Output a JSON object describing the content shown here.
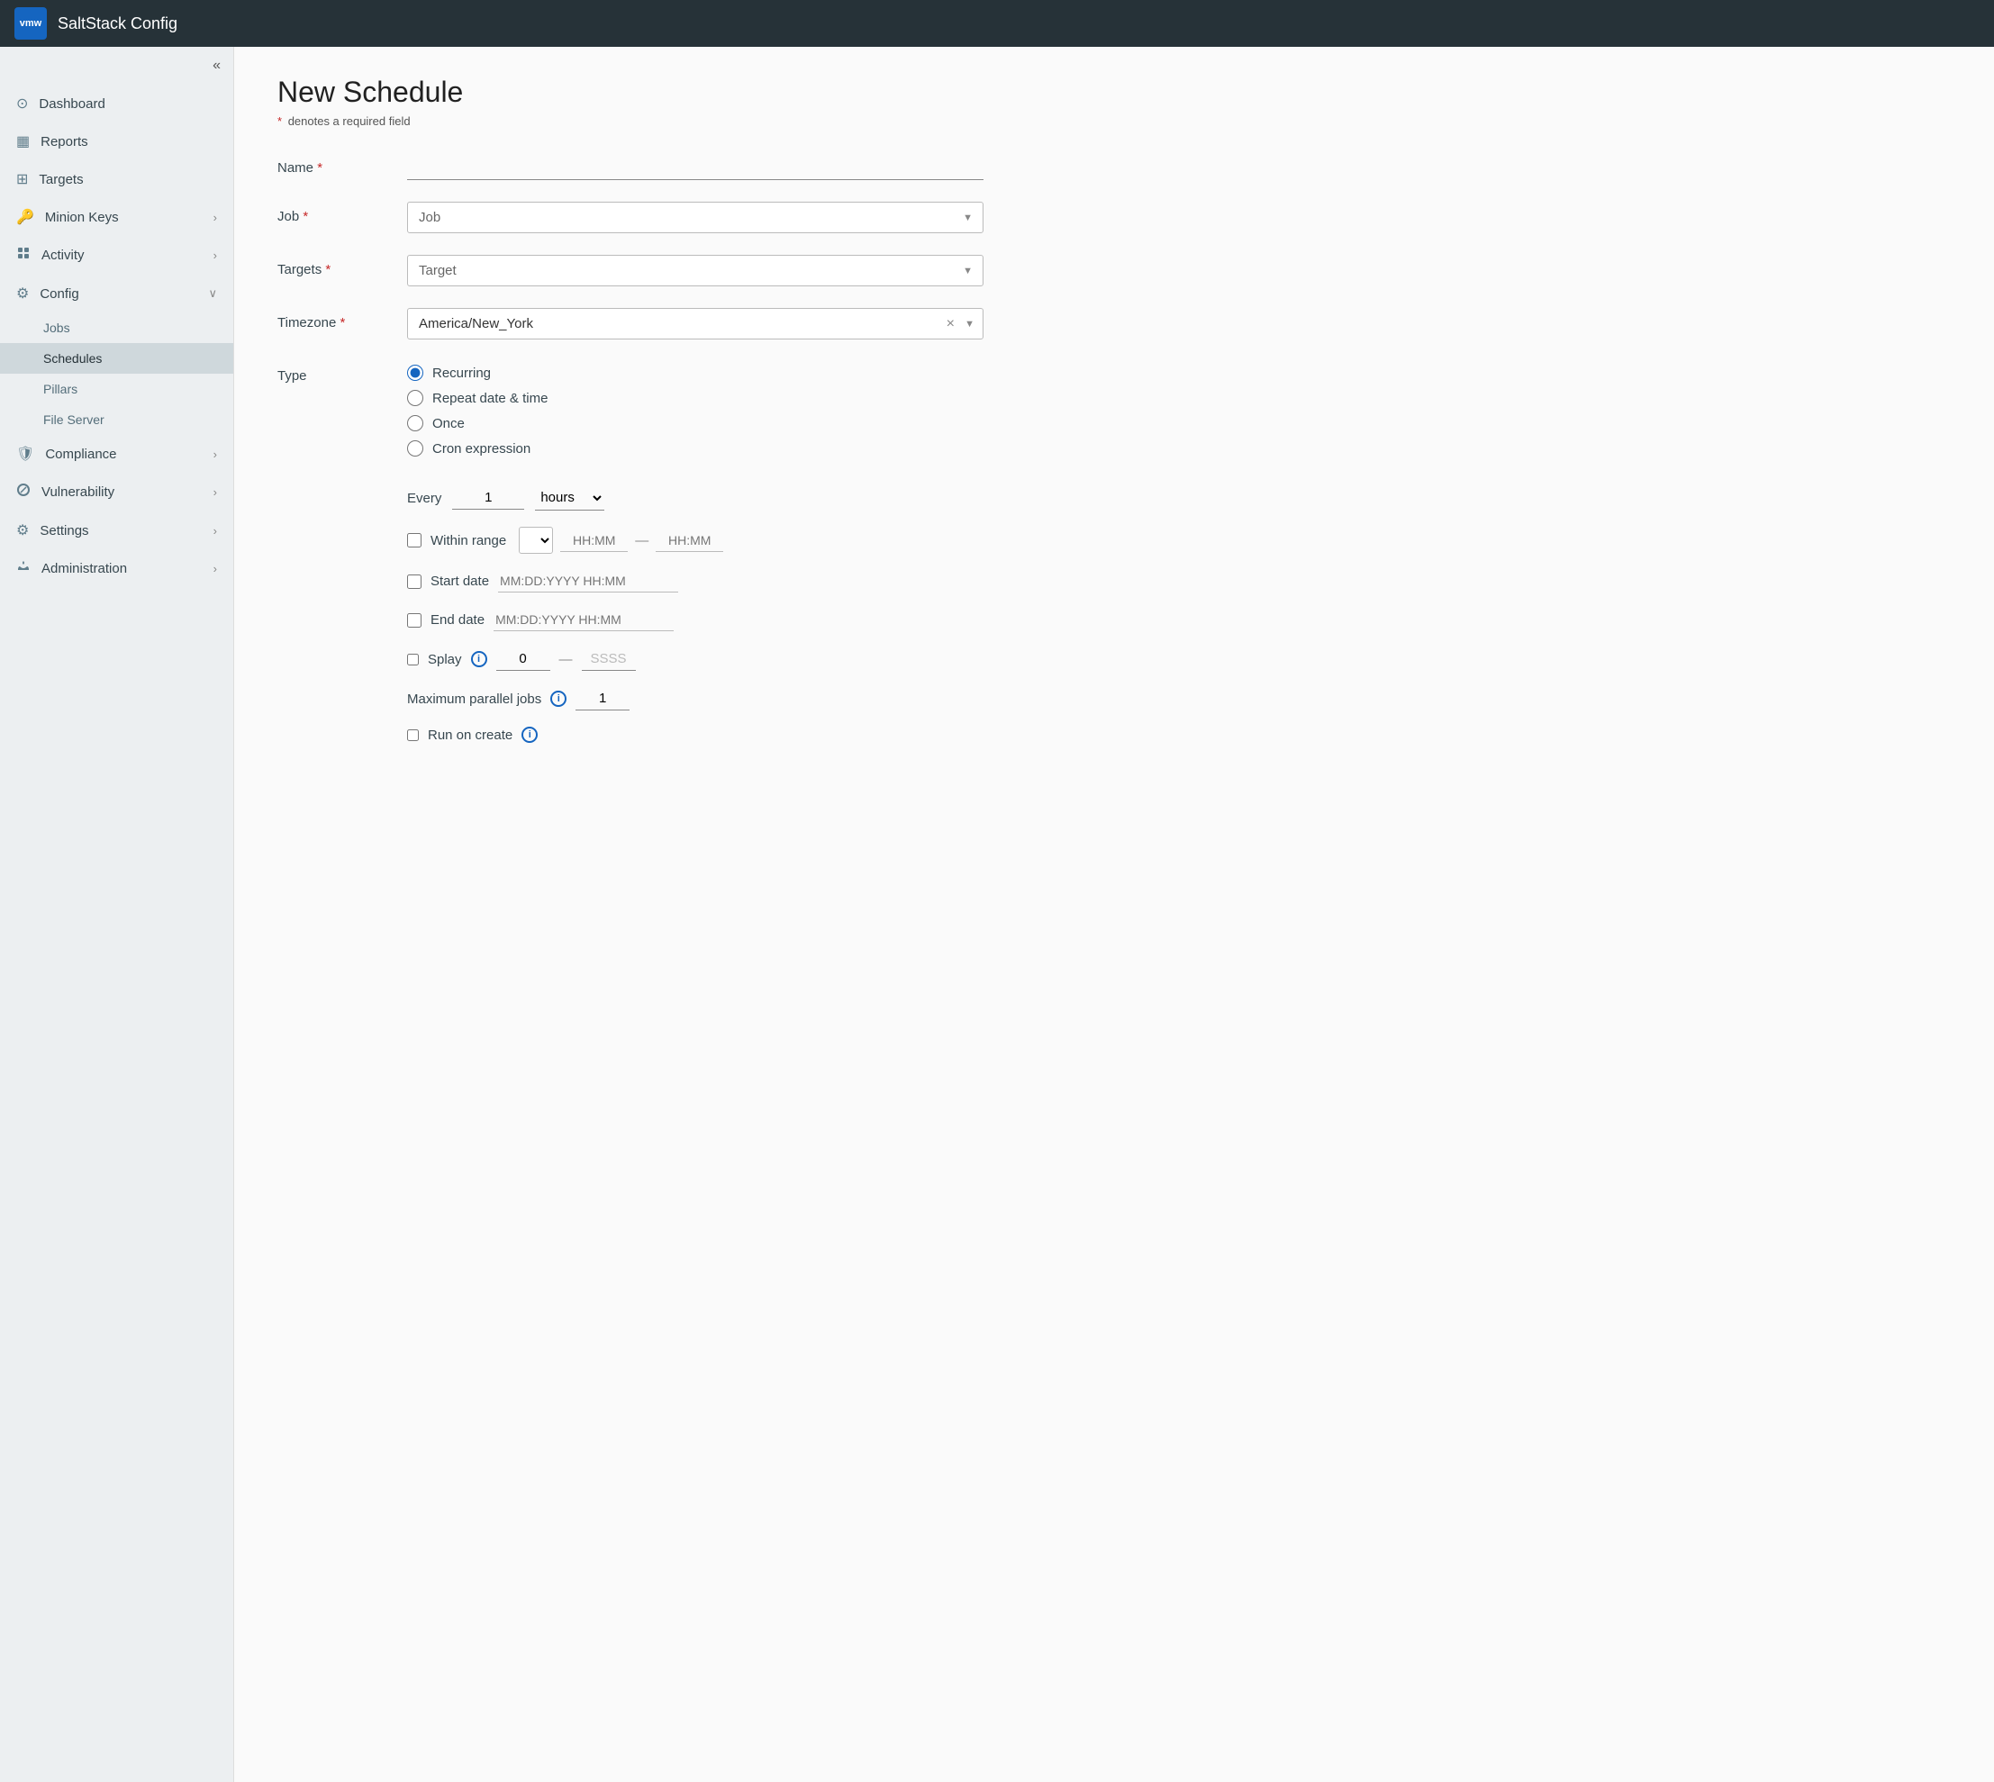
{
  "app": {
    "logo": "vmw",
    "title": "SaltStack Config"
  },
  "sidebar": {
    "collapse_label": "«",
    "items": [
      {
        "id": "dashboard",
        "label": "Dashboard",
        "icon": "⊙",
        "has_chevron": false
      },
      {
        "id": "reports",
        "label": "Reports",
        "icon": "▦",
        "has_chevron": false
      },
      {
        "id": "targets",
        "label": "Targets",
        "icon": "⊞",
        "has_chevron": false
      },
      {
        "id": "minion-keys",
        "label": "Minion Keys",
        "icon": "🔑",
        "has_chevron": true
      },
      {
        "id": "activity",
        "label": "Activity",
        "icon": "⚙",
        "has_chevron": true
      },
      {
        "id": "config",
        "label": "Config",
        "icon": "⚙",
        "has_chevron": true,
        "expanded": true
      }
    ],
    "config_subitems": [
      {
        "id": "jobs",
        "label": "Jobs",
        "active": false
      },
      {
        "id": "schedules",
        "label": "Schedules",
        "active": true
      },
      {
        "id": "pillars",
        "label": "Pillars",
        "active": false
      },
      {
        "id": "file-server",
        "label": "File Server",
        "active": false
      }
    ],
    "bottom_items": [
      {
        "id": "compliance",
        "label": "Compliance",
        "icon": "🛡",
        "has_chevron": true
      },
      {
        "id": "vulnerability",
        "label": "Vulnerability",
        "icon": "⚙",
        "has_chevron": true
      },
      {
        "id": "settings",
        "label": "Settings",
        "icon": "⚙",
        "has_chevron": true
      },
      {
        "id": "administration",
        "label": "Administration",
        "icon": "⚙",
        "has_chevron": true
      }
    ]
  },
  "page": {
    "title": "New Schedule",
    "required_note": "denotes a required field"
  },
  "form": {
    "name_label": "Name",
    "name_placeholder": "",
    "job_label": "Job",
    "job_placeholder": "Job",
    "targets_label": "Targets",
    "targets_placeholder": "Target",
    "timezone_label": "Timezone",
    "timezone_value": "America/New_York",
    "type_label": "Type",
    "type_options": [
      {
        "id": "recurring",
        "label": "Recurring",
        "checked": true
      },
      {
        "id": "repeat",
        "label": "Repeat date & time",
        "checked": false
      },
      {
        "id": "once",
        "label": "Once",
        "checked": false
      },
      {
        "id": "cron",
        "label": "Cron expression",
        "checked": false
      }
    ],
    "every_label": "Every",
    "every_value": "1",
    "every_unit": "hours",
    "within_range_label": "Within range",
    "time_placeholder_start": "HH:MM",
    "time_placeholder_end": "HH:MM",
    "start_date_label": "Start date",
    "start_date_placeholder": "MM:DD:YYYY HH:MM",
    "end_date_label": "End date",
    "end_date_placeholder": "MM:DD:YYYY HH:MM",
    "splay_label": "Splay",
    "splay_value": "0",
    "splay_unit": "SSSS",
    "max_parallel_label": "Maximum parallel jobs",
    "max_parallel_value": "1",
    "run_on_create_label": "Run on create"
  }
}
